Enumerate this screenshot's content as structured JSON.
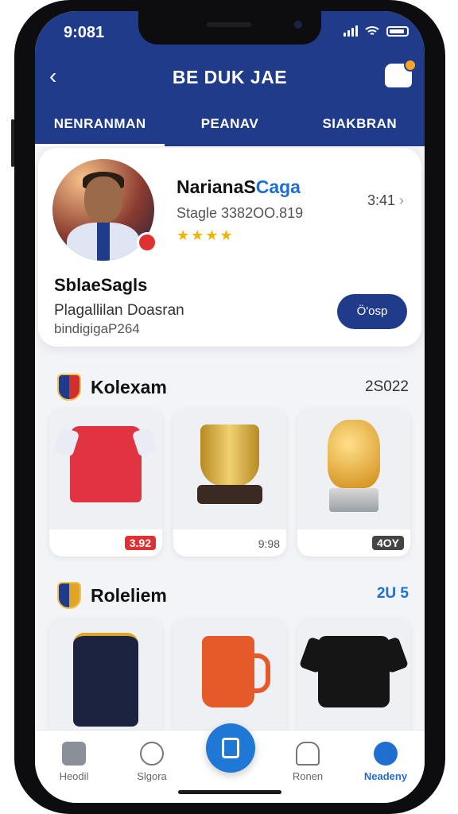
{
  "status": {
    "time": "9:081"
  },
  "header": {
    "title": "BE DUK JAE",
    "back_glyph": "‹"
  },
  "tabs": [
    {
      "label": "NENRANMAN",
      "active": true
    },
    {
      "label": "PEANAV",
      "active": false
    },
    {
      "label": "SIAKBRAN",
      "active": false
    }
  ],
  "profile": {
    "name_main": "NarianaS",
    "name_accent": "Caga",
    "stat": "Stagle 3382OO.819",
    "stars": "★★★★",
    "time": "3:41",
    "subname": "SblaeSagls",
    "bio_line1": "Plagallilan Doasran",
    "bio_line2": "bindigigaP264",
    "action_label": "Ö'osp"
  },
  "sections": [
    {
      "title": "Kolexam",
      "count": "2S022",
      "items": [
        {
          "price": "3.92",
          "price_style": "red",
          "kind": "jersey"
        },
        {
          "price": "9:98",
          "price_style": "plain",
          "kind": "cup"
        },
        {
          "price": "4OY",
          "price_style": "gray",
          "kind": "trophy"
        }
      ]
    },
    {
      "title": "Roleliem",
      "count": "2U 5",
      "items": [
        {
          "price": "",
          "price_style": "plain",
          "kind": "tank"
        },
        {
          "price": "",
          "price_style": "plain",
          "kind": "mug"
        },
        {
          "price": "",
          "price_style": "plain",
          "kind": "shirt"
        }
      ]
    }
  ],
  "bottom_nav": [
    {
      "label": "Heodil",
      "icon": "home-icon",
      "active": false
    },
    {
      "label": "Slgora",
      "icon": "compass-icon",
      "active": false
    },
    {
      "label": "",
      "icon": "edit-icon",
      "active": false,
      "fab": true
    },
    {
      "label": "Ronen",
      "icon": "bell-icon",
      "active": false
    },
    {
      "label": "Neadeny",
      "icon": "user-icon",
      "active": true
    }
  ],
  "colors": {
    "primary": "#1f3b8a",
    "accent_blue": "#1f6fd1",
    "star": "#f2b400",
    "badge_red": "#e03131"
  }
}
